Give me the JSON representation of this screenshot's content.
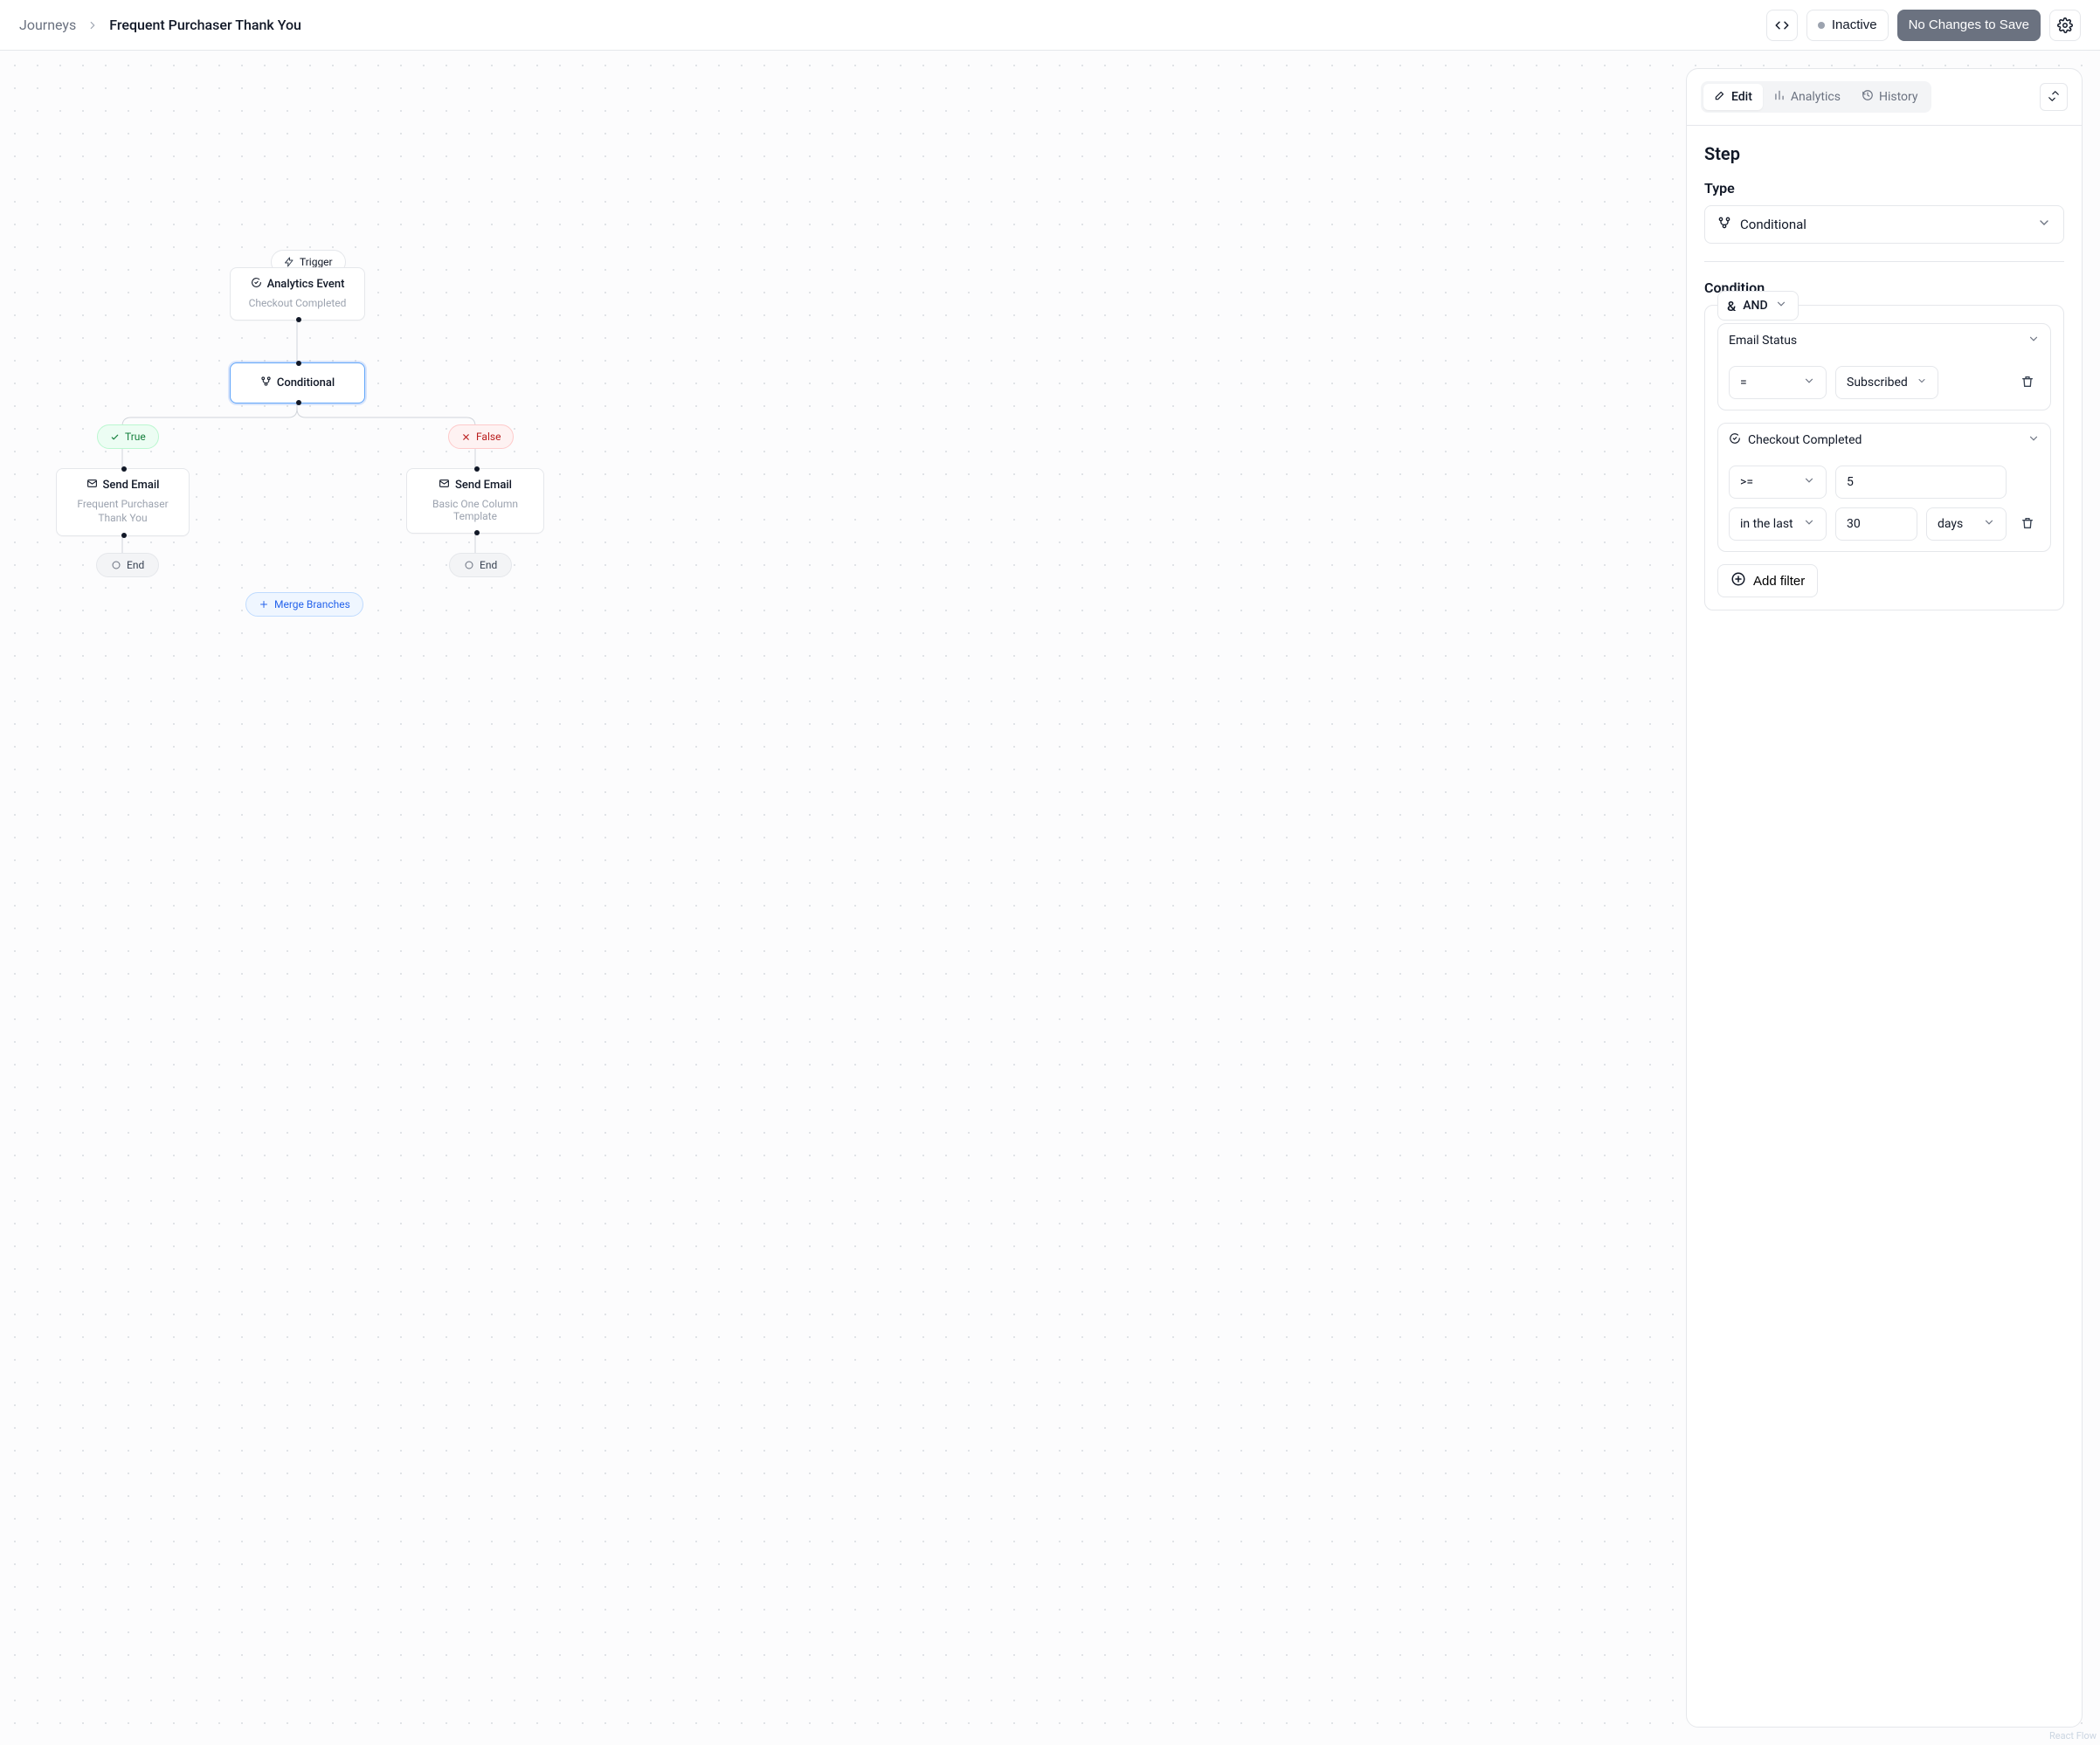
{
  "breadcrumb": {
    "root": "Journeys",
    "current": "Frequent Purchaser Thank You"
  },
  "header": {
    "status_label": "Inactive",
    "save_label": "No Changes to Save"
  },
  "flow": {
    "trigger_pill": "Trigger",
    "trigger_title": "Analytics Event",
    "trigger_sub": "Checkout Completed",
    "conditional_title": "Conditional",
    "true_label": "True",
    "false_label": "False",
    "left_email_title": "Send Email",
    "left_email_sub": "Frequent Purchaser Thank You",
    "right_email_title": "Send Email",
    "right_email_sub": "Basic One Column Template",
    "end_label": "End",
    "merge_label": "Merge Branches"
  },
  "panel": {
    "tabs": {
      "edit": "Edit",
      "analytics": "Analytics",
      "history": "History"
    },
    "step_heading": "Step",
    "type_label": "Type",
    "type_value": "Conditional",
    "condition_heading": "Condition",
    "logic_label": "AND",
    "add_filter": "Add filter",
    "filter1": {
      "field": "Email Status",
      "op": "=",
      "value": "Subscribed"
    },
    "filter2": {
      "field": "Checkout Completed",
      "op": ">=",
      "count": "5",
      "window_rel": "in the last",
      "window_val": "30",
      "window_unit": "days"
    }
  },
  "attribution": "React Flow"
}
